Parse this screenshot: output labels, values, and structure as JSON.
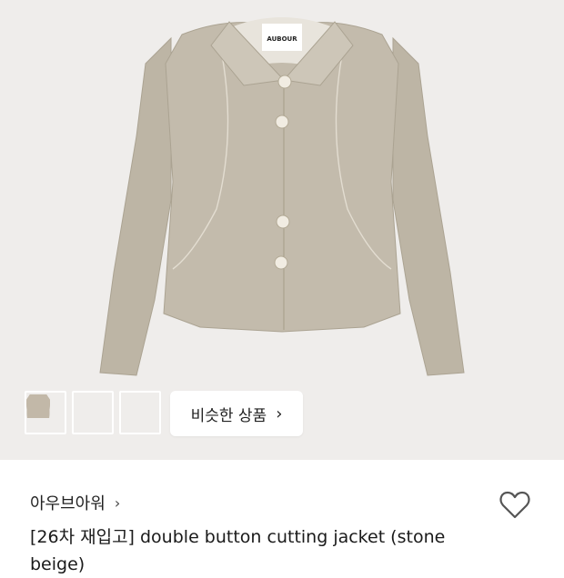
{
  "product": {
    "tag_label": "AUBOUR",
    "brand_name": "아우브아워",
    "brand_chevron": "›",
    "title": "[26차 재입고] double button cutting jacket (stone beige)"
  },
  "gallery": {
    "thumbnails": [
      {
        "color": "#4a3f36",
        "name": "brown"
      },
      {
        "color": "#e6d5bb",
        "name": "cream"
      },
      {
        "color": "#c2b8a8",
        "name": "stone-beige"
      }
    ],
    "similar_label": "비슷한 상품",
    "similar_chevron": "›"
  },
  "colors": {
    "hero_bg": "#efedeb",
    "jacket": "#c3bbac"
  },
  "icons": {
    "wishlist": "heart-icon"
  }
}
